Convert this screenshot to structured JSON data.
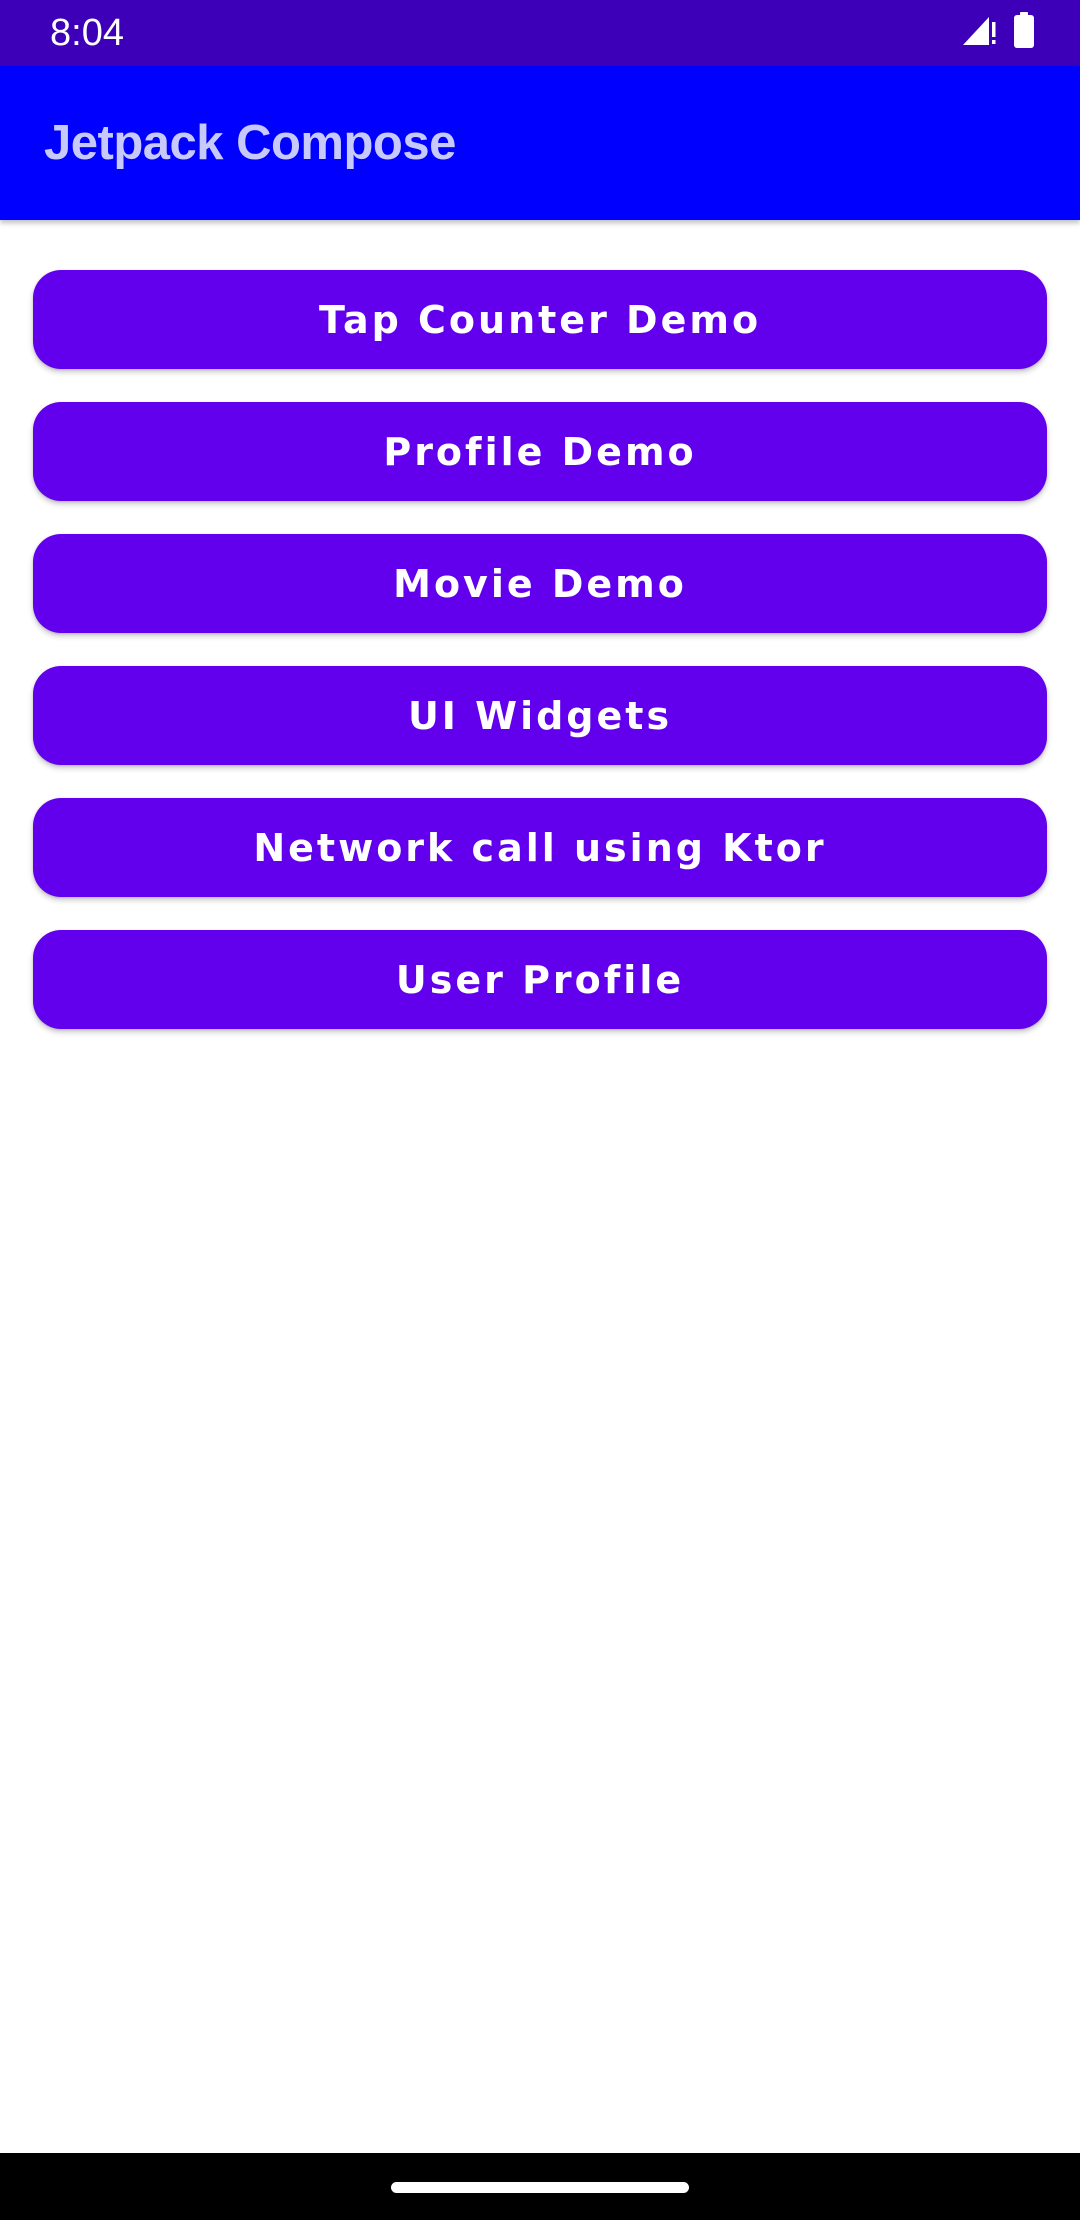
{
  "status_bar": {
    "time": "8:04",
    "icons": [
      "signal-icon",
      "battery-icon"
    ]
  },
  "app_bar": {
    "title": "Jetpack Compose"
  },
  "menu": {
    "buttons": [
      {
        "label": "Tap Counter Demo"
      },
      {
        "label": "Profile Demo"
      },
      {
        "label": "Movie Demo"
      },
      {
        "label": "UI Widgets"
      },
      {
        "label": "Network call using Ktor"
      },
      {
        "label": "User Profile"
      }
    ]
  },
  "colors": {
    "status_bar": "#3d00b8",
    "app_bar": "#0000ff",
    "title_text": "#c7c9fb",
    "button": "#6200ee",
    "button_text": "#ffffff",
    "nav_bar": "#000000"
  }
}
